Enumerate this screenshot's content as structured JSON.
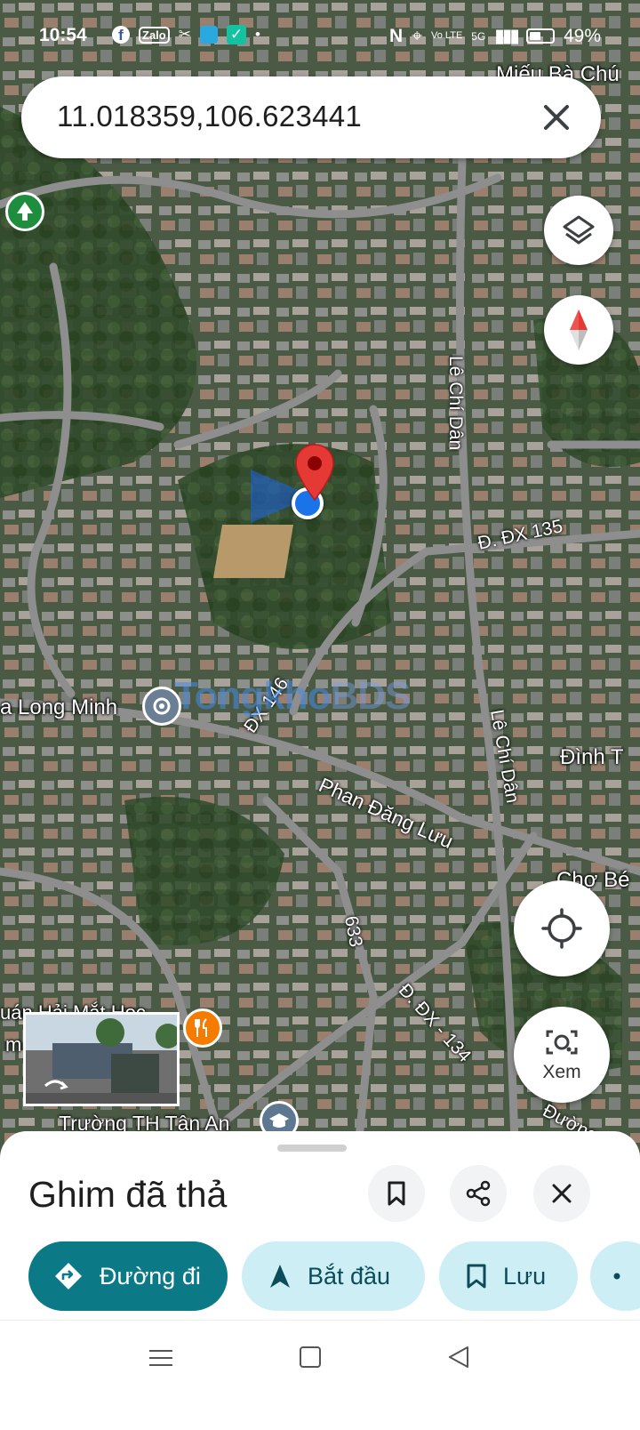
{
  "status_bar": {
    "time": "10:54",
    "app_icons": [
      "facebook-icon",
      "zalo-icon",
      "capcut-icon",
      "tiktok-icon",
      "messenger-icon"
    ],
    "zalo_text": "Zalo",
    "network": "Vo LTE",
    "signal": "5G",
    "battery": "49%"
  },
  "search": {
    "value": "11.018359,106.623441"
  },
  "map": {
    "labels": {
      "mieu": "Miếu Bà Chú",
      "le_chi_dan_top": "Lê Chí Dân",
      "le_chi_dan_bottom": "Lê Chí Dân",
      "dx135": "Đ. ĐX 135",
      "long_minh": "a Long Minh",
      "dx146": "ĐX 146",
      "phan_dang_luu": "Phan Đăng Lưu",
      "dinh": "Đình T",
      "cho": "Chợ Bé",
      "r633": "633",
      "dx134": "Đ. ĐX - 134",
      "quan": "uán Hải Mắt Hoc",
      "quan_sub": "m",
      "truong": "Trường TH Tân An",
      "duong": "Đường D"
    },
    "watermark_a": "Tongkho",
    "watermark_b": "BDS"
  },
  "controls": {
    "lens_label": "Xem"
  },
  "sheet": {
    "title": "Ghim đã thả",
    "directions_label": "Đường đi",
    "start_label": "Bắt đầu",
    "save_label": "Lưu"
  },
  "colors": {
    "accent": "#0b7986",
    "chip_bg": "#cdeef5",
    "pin": "#e53935",
    "location": "#1a73e8"
  }
}
